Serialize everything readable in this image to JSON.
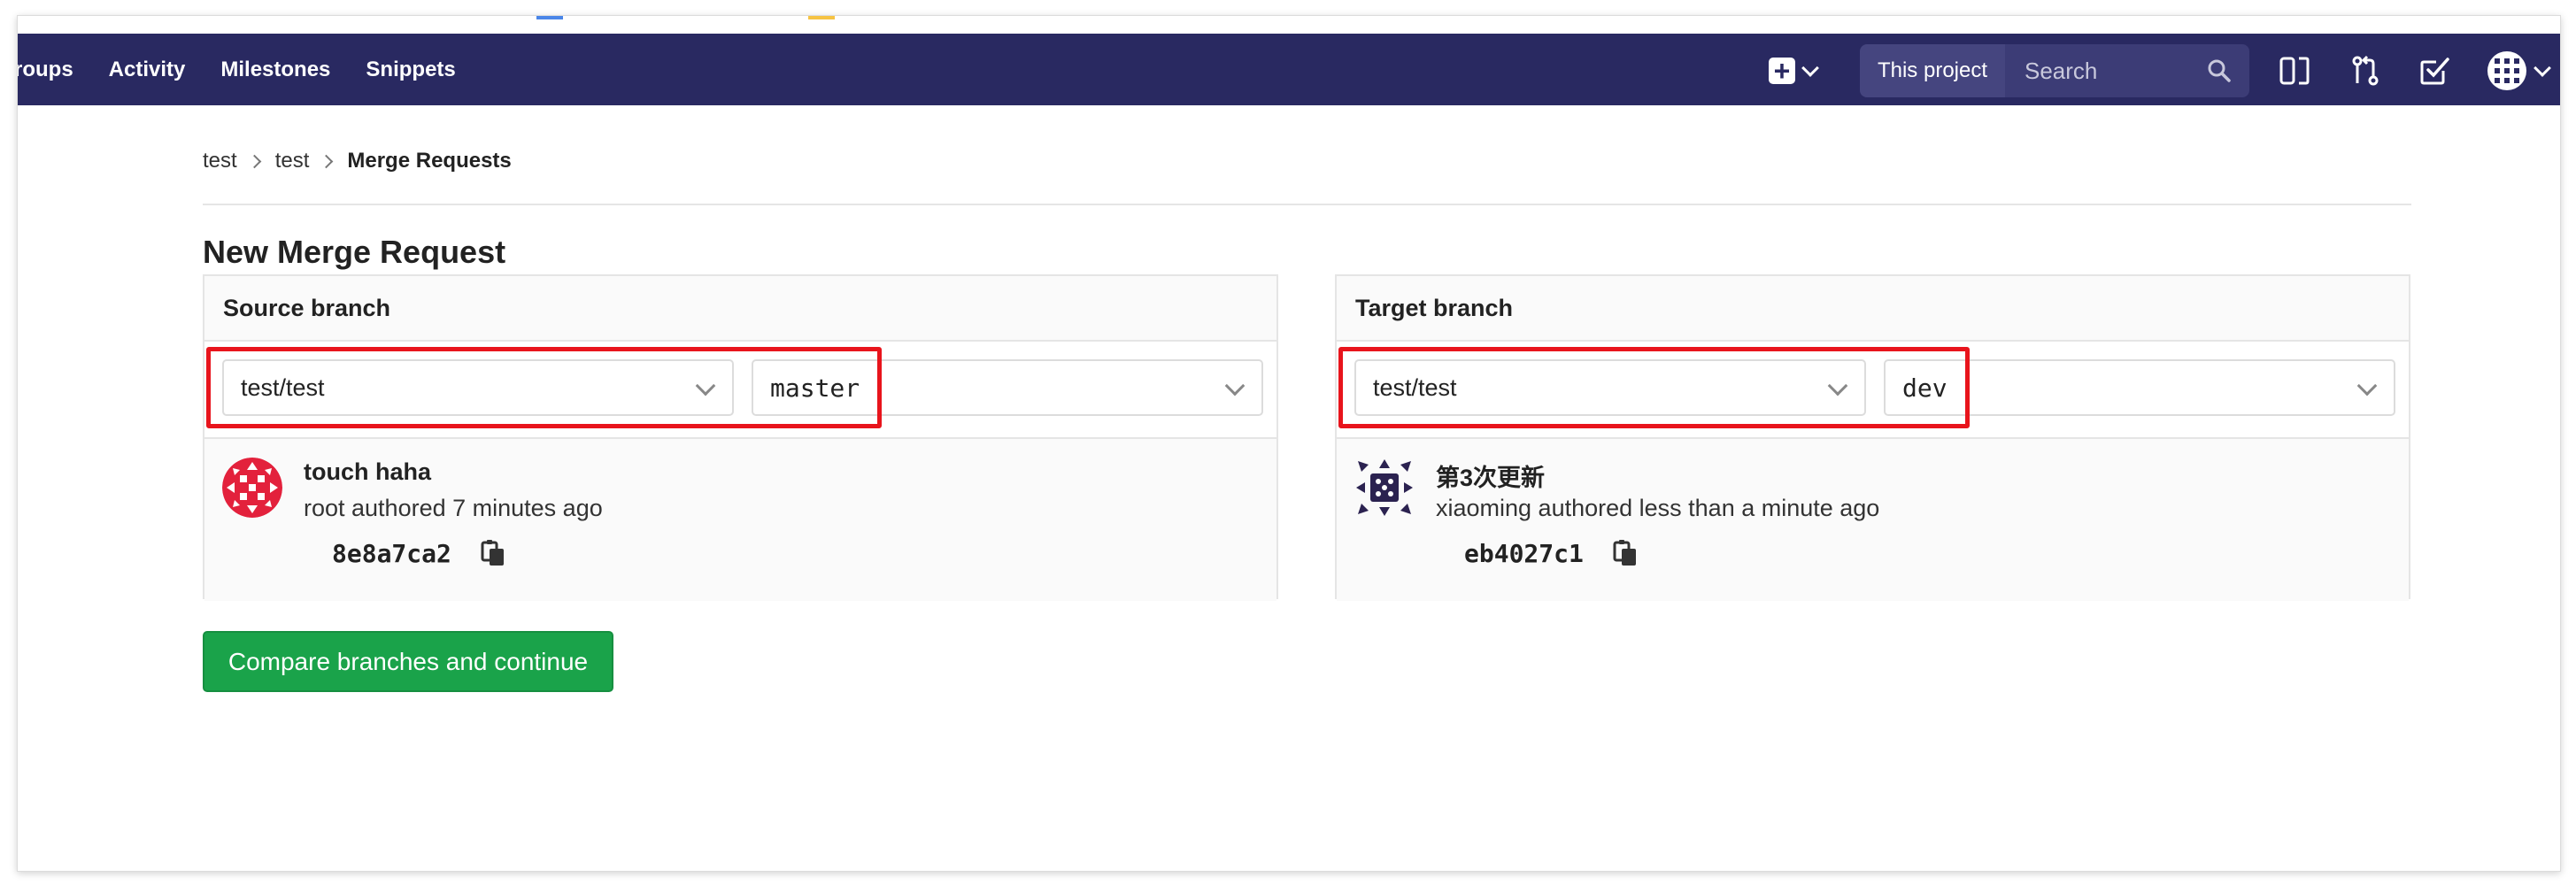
{
  "nav": {
    "links": [
      "roups",
      "Activity",
      "Milestones",
      "Snippets"
    ],
    "search_scope": "This project",
    "search_placeholder": "Search"
  },
  "breadcrumb": {
    "items": [
      "test",
      "test"
    ],
    "current": "Merge Requests"
  },
  "page": {
    "title": "New Merge Request",
    "compare_button": "Compare branches and continue"
  },
  "source": {
    "heading": "Source branch",
    "project": "test/test",
    "branch": "master",
    "commit": {
      "title": "touch haha",
      "meta": "root authored 7 minutes ago",
      "sha": "8e8a7ca2"
    }
  },
  "target": {
    "heading": "Target branch",
    "project": "test/test",
    "branch": "dev",
    "commit": {
      "title": "第3次更新",
      "meta": "xiaoming authored less than a minute ago",
      "sha": "eb4027c1"
    }
  },
  "colors": {
    "navbar": "#292961",
    "primary_button": "#1aa34a",
    "highlight": "#e8141c"
  }
}
